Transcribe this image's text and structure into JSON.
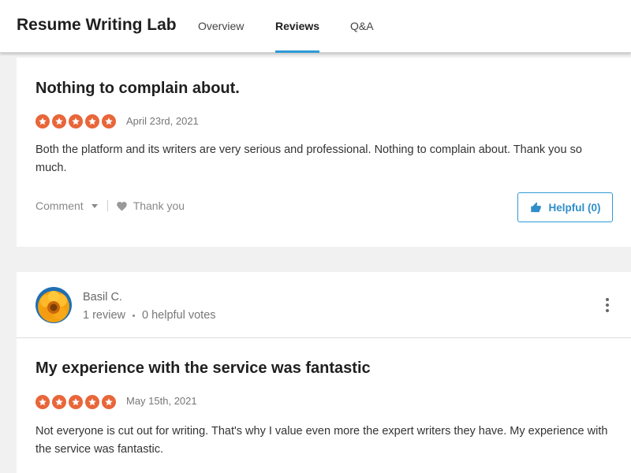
{
  "header": {
    "brand": "Resume Writing Lab",
    "tabs": [
      {
        "label": "Overview",
        "active": false
      },
      {
        "label": "Reviews",
        "active": true
      },
      {
        "label": "Q&A",
        "active": false
      }
    ]
  },
  "colors": {
    "accent": "#2e9bd6",
    "star": "#e8663a",
    "background": "#f1f1f1"
  },
  "reviews": [
    {
      "title": "Nothing to complain about.",
      "rating": 5,
      "date": "April 23rd, 2021",
      "body": "Both the platform and its writers are very serious and professional. Nothing to complain about. Thank you so much.",
      "actions": {
        "comment_label": "Comment",
        "thank_label": "Thank you",
        "helpful_label": "Helpful (0)"
      }
    },
    {
      "reviewer": {
        "name": "Basil C.",
        "review_count": "1 review",
        "helpful_votes": "0 helpful votes",
        "avatar_icon": "sunflower-avatar"
      },
      "title": "My experience with the service was fantastic",
      "rating": 5,
      "date": "May 15th, 2021",
      "body": "Not everyone is cut out for writing. That's why I value even more the expert writers they have. My experience with the service was fantastic."
    }
  ]
}
